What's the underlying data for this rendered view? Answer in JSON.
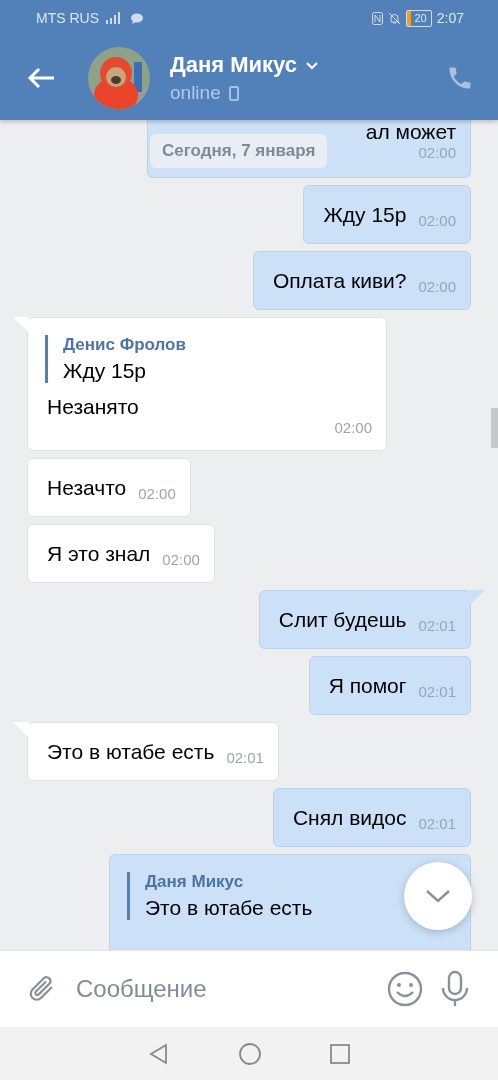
{
  "status_bar": {
    "carrier": "MTS RUS",
    "battery": "20",
    "time": "2:07"
  },
  "header": {
    "name": "Даня Микус",
    "status": "online"
  },
  "date_chip": "Сегодня, 7 января",
  "messages": [
    {
      "kind": "out",
      "text": "ал может",
      "time": "02:00",
      "tail": false,
      "partial": true
    },
    {
      "kind": "out",
      "text": "Жду 15р",
      "time": "02:00",
      "tail": false
    },
    {
      "kind": "out",
      "text": "Оплата киви?",
      "time": "02:00",
      "tail": false
    },
    {
      "kind": "in",
      "reply": {
        "author": "Денис Фролов",
        "text": "Жду 15р"
      },
      "text": "Незанято",
      "time": "02:00",
      "tail": true
    },
    {
      "kind": "in",
      "text": "Незачто",
      "time": "02:00",
      "tail": false
    },
    {
      "kind": "in",
      "text": "Я это знал",
      "time": "02:00",
      "tail": false
    },
    {
      "kind": "out",
      "text": "Слит будешь",
      "time": "02:01",
      "tail": true
    },
    {
      "kind": "out",
      "text": "Я помог",
      "time": "02:01",
      "tail": false
    },
    {
      "kind": "in",
      "text": "Это в ютабе есть",
      "time": "02:01",
      "tail": true
    },
    {
      "kind": "out",
      "text": "Снял видос",
      "time": "02:01",
      "tail": false
    },
    {
      "kind": "out",
      "reply": {
        "author": "Даня Микус",
        "text": "Это в ютабе есть"
      },
      "tail": false,
      "cut": true
    }
  ],
  "composer": {
    "placeholder": "Сообщение"
  }
}
